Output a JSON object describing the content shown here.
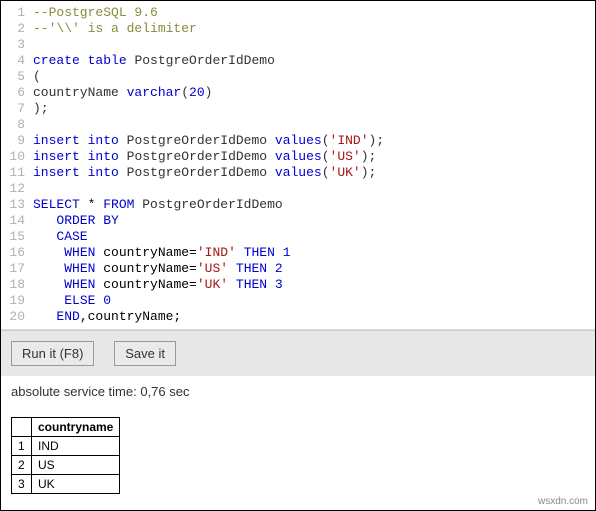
{
  "editor": {
    "lines": [
      {
        "num": 1,
        "tokens": [
          {
            "cls": "comment",
            "t": "--PostgreSQL 9.6"
          }
        ]
      },
      {
        "num": 2,
        "tokens": [
          {
            "cls": "comment",
            "t": "--'\\\\' is a delimiter"
          }
        ]
      },
      {
        "num": 3,
        "tokens": []
      },
      {
        "num": 4,
        "tokens": [
          {
            "cls": "keyword",
            "t": "create"
          },
          {
            "cls": "",
            "t": " "
          },
          {
            "cls": "keyword",
            "t": "table"
          },
          {
            "cls": "",
            "t": " "
          },
          {
            "cls": "identifier",
            "t": "PostgreOrderIdDemo"
          }
        ]
      },
      {
        "num": 5,
        "tokens": [
          {
            "cls": "paren",
            "t": "("
          }
        ]
      },
      {
        "num": 6,
        "tokens": [
          {
            "cls": "identifier",
            "t": "countryName "
          },
          {
            "cls": "keyword",
            "t": "varchar"
          },
          {
            "cls": "paren",
            "t": "("
          },
          {
            "cls": "number",
            "t": "20"
          },
          {
            "cls": "paren",
            "t": ")"
          }
        ]
      },
      {
        "num": 7,
        "tokens": [
          {
            "cls": "paren",
            "t": ");"
          }
        ]
      },
      {
        "num": 8,
        "tokens": []
      },
      {
        "num": 9,
        "tokens": [
          {
            "cls": "keyword",
            "t": "insert"
          },
          {
            "cls": "",
            "t": " "
          },
          {
            "cls": "keyword",
            "t": "into"
          },
          {
            "cls": "",
            "t": " "
          },
          {
            "cls": "identifier",
            "t": "PostgreOrderIdDemo "
          },
          {
            "cls": "keyword",
            "t": "values"
          },
          {
            "cls": "paren",
            "t": "("
          },
          {
            "cls": "string",
            "t": "'IND'"
          },
          {
            "cls": "paren",
            "t": ");"
          }
        ]
      },
      {
        "num": 10,
        "tokens": [
          {
            "cls": "keyword",
            "t": "insert"
          },
          {
            "cls": "",
            "t": " "
          },
          {
            "cls": "keyword",
            "t": "into"
          },
          {
            "cls": "",
            "t": " "
          },
          {
            "cls": "identifier",
            "t": "PostgreOrderIdDemo "
          },
          {
            "cls": "keyword",
            "t": "values"
          },
          {
            "cls": "paren",
            "t": "("
          },
          {
            "cls": "string",
            "t": "'US'"
          },
          {
            "cls": "paren",
            "t": ");"
          }
        ]
      },
      {
        "num": 11,
        "tokens": [
          {
            "cls": "keyword",
            "t": "insert"
          },
          {
            "cls": "",
            "t": " "
          },
          {
            "cls": "keyword",
            "t": "into"
          },
          {
            "cls": "",
            "t": " "
          },
          {
            "cls": "identifier",
            "t": "PostgreOrderIdDemo "
          },
          {
            "cls": "keyword",
            "t": "values"
          },
          {
            "cls": "paren",
            "t": "("
          },
          {
            "cls": "string",
            "t": "'UK'"
          },
          {
            "cls": "paren",
            "t": ");"
          }
        ]
      },
      {
        "num": 12,
        "tokens": []
      },
      {
        "num": 13,
        "tokens": [
          {
            "cls": "keyword",
            "t": "SELECT"
          },
          {
            "cls": "",
            "t": " * "
          },
          {
            "cls": "keyword",
            "t": "FROM"
          },
          {
            "cls": "",
            "t": " "
          },
          {
            "cls": "identifier",
            "t": "PostgreOrderIdDemo"
          }
        ]
      },
      {
        "num": 14,
        "tokens": [
          {
            "cls": "",
            "t": "   "
          },
          {
            "cls": "keyword",
            "t": "ORDER BY"
          }
        ]
      },
      {
        "num": 15,
        "tokens": [
          {
            "cls": "",
            "t": "   "
          },
          {
            "cls": "keyword",
            "t": "CASE"
          }
        ]
      },
      {
        "num": 16,
        "tokens": [
          {
            "cls": "",
            "t": "    "
          },
          {
            "cls": "keyword",
            "t": "WHEN"
          },
          {
            "cls": "",
            "t": " countryName="
          },
          {
            "cls": "string",
            "t": "'IND'"
          },
          {
            "cls": "",
            "t": " "
          },
          {
            "cls": "keyword",
            "t": "THEN"
          },
          {
            "cls": "",
            "t": " "
          },
          {
            "cls": "number",
            "t": "1"
          }
        ]
      },
      {
        "num": 17,
        "tokens": [
          {
            "cls": "",
            "t": "    "
          },
          {
            "cls": "keyword",
            "t": "WHEN"
          },
          {
            "cls": "",
            "t": " countryName="
          },
          {
            "cls": "string",
            "t": "'US'"
          },
          {
            "cls": "",
            "t": " "
          },
          {
            "cls": "keyword",
            "t": "THEN"
          },
          {
            "cls": "",
            "t": " "
          },
          {
            "cls": "number",
            "t": "2"
          }
        ]
      },
      {
        "num": 18,
        "tokens": [
          {
            "cls": "",
            "t": "    "
          },
          {
            "cls": "keyword",
            "t": "WHEN"
          },
          {
            "cls": "",
            "t": " countryName="
          },
          {
            "cls": "string",
            "t": "'UK'"
          },
          {
            "cls": "",
            "t": " "
          },
          {
            "cls": "keyword",
            "t": "THEN"
          },
          {
            "cls": "",
            "t": " "
          },
          {
            "cls": "number",
            "t": "3"
          }
        ]
      },
      {
        "num": 19,
        "tokens": [
          {
            "cls": "",
            "t": "    "
          },
          {
            "cls": "keyword",
            "t": "ELSE"
          },
          {
            "cls": "",
            "t": " "
          },
          {
            "cls": "number",
            "t": "0"
          }
        ]
      },
      {
        "num": 20,
        "tokens": [
          {
            "cls": "",
            "t": "   "
          },
          {
            "cls": "keyword",
            "t": "END"
          },
          {
            "cls": "",
            "t": ",countryName;"
          }
        ]
      }
    ]
  },
  "controls": {
    "run_label": "Run it (F8)",
    "save_label": "Save it"
  },
  "status": {
    "text": "absolute service time: 0,76 sec"
  },
  "results": {
    "header": "countryname",
    "rows": [
      {
        "num": "1",
        "val": "IND"
      },
      {
        "num": "2",
        "val": "US"
      },
      {
        "num": "3",
        "val": "UK"
      }
    ]
  },
  "watermark": "wsxdn.com"
}
